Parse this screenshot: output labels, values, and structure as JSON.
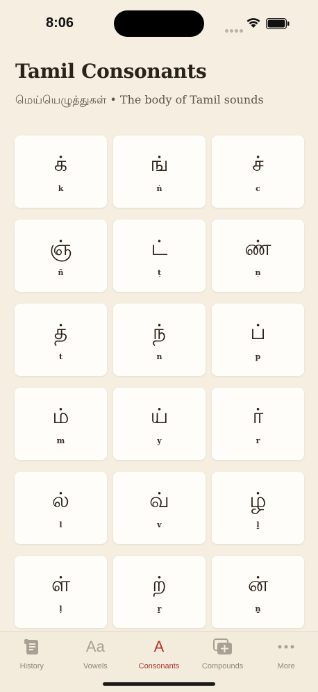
{
  "status_bar": {
    "time": "8:06"
  },
  "header": {
    "title": "Tamil Consonants",
    "subtitle": "மெய்யெழுத்துகள் • The body of Tamil sounds"
  },
  "consonants": [
    {
      "glyph": "க்",
      "translit": "k"
    },
    {
      "glyph": "ங்",
      "translit": "ṅ"
    },
    {
      "glyph": "ச்",
      "translit": "c"
    },
    {
      "glyph": "ஞ்",
      "translit": "ñ"
    },
    {
      "glyph": "ட்",
      "translit": "ṭ"
    },
    {
      "glyph": "ண்",
      "translit": "ṇ"
    },
    {
      "glyph": "த்",
      "translit": "t"
    },
    {
      "glyph": "ந்",
      "translit": "n"
    },
    {
      "glyph": "ப்",
      "translit": "p"
    },
    {
      "glyph": "ம்",
      "translit": "m"
    },
    {
      "glyph": "ய்",
      "translit": "y"
    },
    {
      "glyph": "ர்",
      "translit": "r"
    },
    {
      "glyph": "ல்",
      "translit": "l"
    },
    {
      "glyph": "வ்",
      "translit": "v"
    },
    {
      "glyph": "ழ்",
      "translit": "ḻ"
    },
    {
      "glyph": "ள்",
      "translit": "ḷ"
    },
    {
      "glyph": "ற்",
      "translit": "ṟ"
    },
    {
      "glyph": "ன்",
      "translit": "ṉ"
    }
  ],
  "tab_bar": {
    "tabs": [
      {
        "label": "History",
        "icon": "scroll-icon"
      },
      {
        "label": "Vowels",
        "icon": "Aa"
      },
      {
        "label": "Consonants",
        "icon": "A",
        "active": true
      },
      {
        "label": "Compounds",
        "icon": "stack-plus-icon"
      },
      {
        "label": "More",
        "icon": "ellipsis-icon"
      }
    ]
  },
  "colors": {
    "background": "#F6EFE1",
    "card": "#FFFDF9",
    "accent": "#B3322C",
    "text": "#2B2118"
  }
}
